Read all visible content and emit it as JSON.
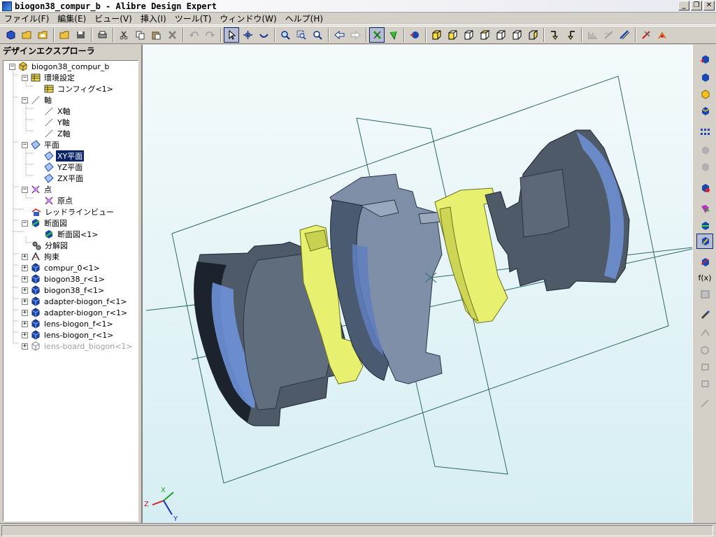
{
  "window": {
    "title": "biogon38_compur_b - Alibre Design Expert"
  },
  "menu": [
    "ファイル(F)",
    "編集(E)",
    "ビュー(V)",
    "挿入(I)",
    "ツール(T)",
    "ウィンドウ(W)",
    "ヘルプ(H)"
  ],
  "explorer": {
    "title": "デザインエクスプローラ",
    "tree": {
      "root": "biogon38_compur_b",
      "env": "環境設定",
      "config": "コンフィグ<1>",
      "axes": "軸",
      "x_axis": "X軸",
      "y_axis": "Y軸",
      "z_axis": "Z軸",
      "planes": "平面",
      "xy_plane": "XY平面",
      "yz_plane": "YZ平面",
      "zx_plane": "ZX平面",
      "points": "点",
      "origin": "原点",
      "redline": "レッドラインビュー",
      "sections": "断面図",
      "section1": "断面図<1>",
      "exploded": "分解図",
      "constraints": "拘束",
      "compur": "compur_0<1>",
      "biogon_r": "biogon38_r<1>",
      "biogon_f": "biogon38_f<1>",
      "adapter_f": "adapter-biogon_f<1>",
      "adapter_r": "adapter-biogon_r<1>",
      "lens_f": "lens-biogon_f<1>",
      "lens_r": "lens-biogon_r<1>",
      "lens_board": "lens-board_biogon<1>"
    }
  },
  "viewport": {
    "triad": {
      "x": "X",
      "y": "Y",
      "z": "Z"
    }
  },
  "right_toolbar": {
    "fx_label": "f(x)"
  },
  "colors": {
    "selection": "#0a246a",
    "part_gray": "#5a6878",
    "part_yellow": "#e8f070",
    "lens_blue": "#6f92d8",
    "plane_line": "#2e6a62"
  }
}
